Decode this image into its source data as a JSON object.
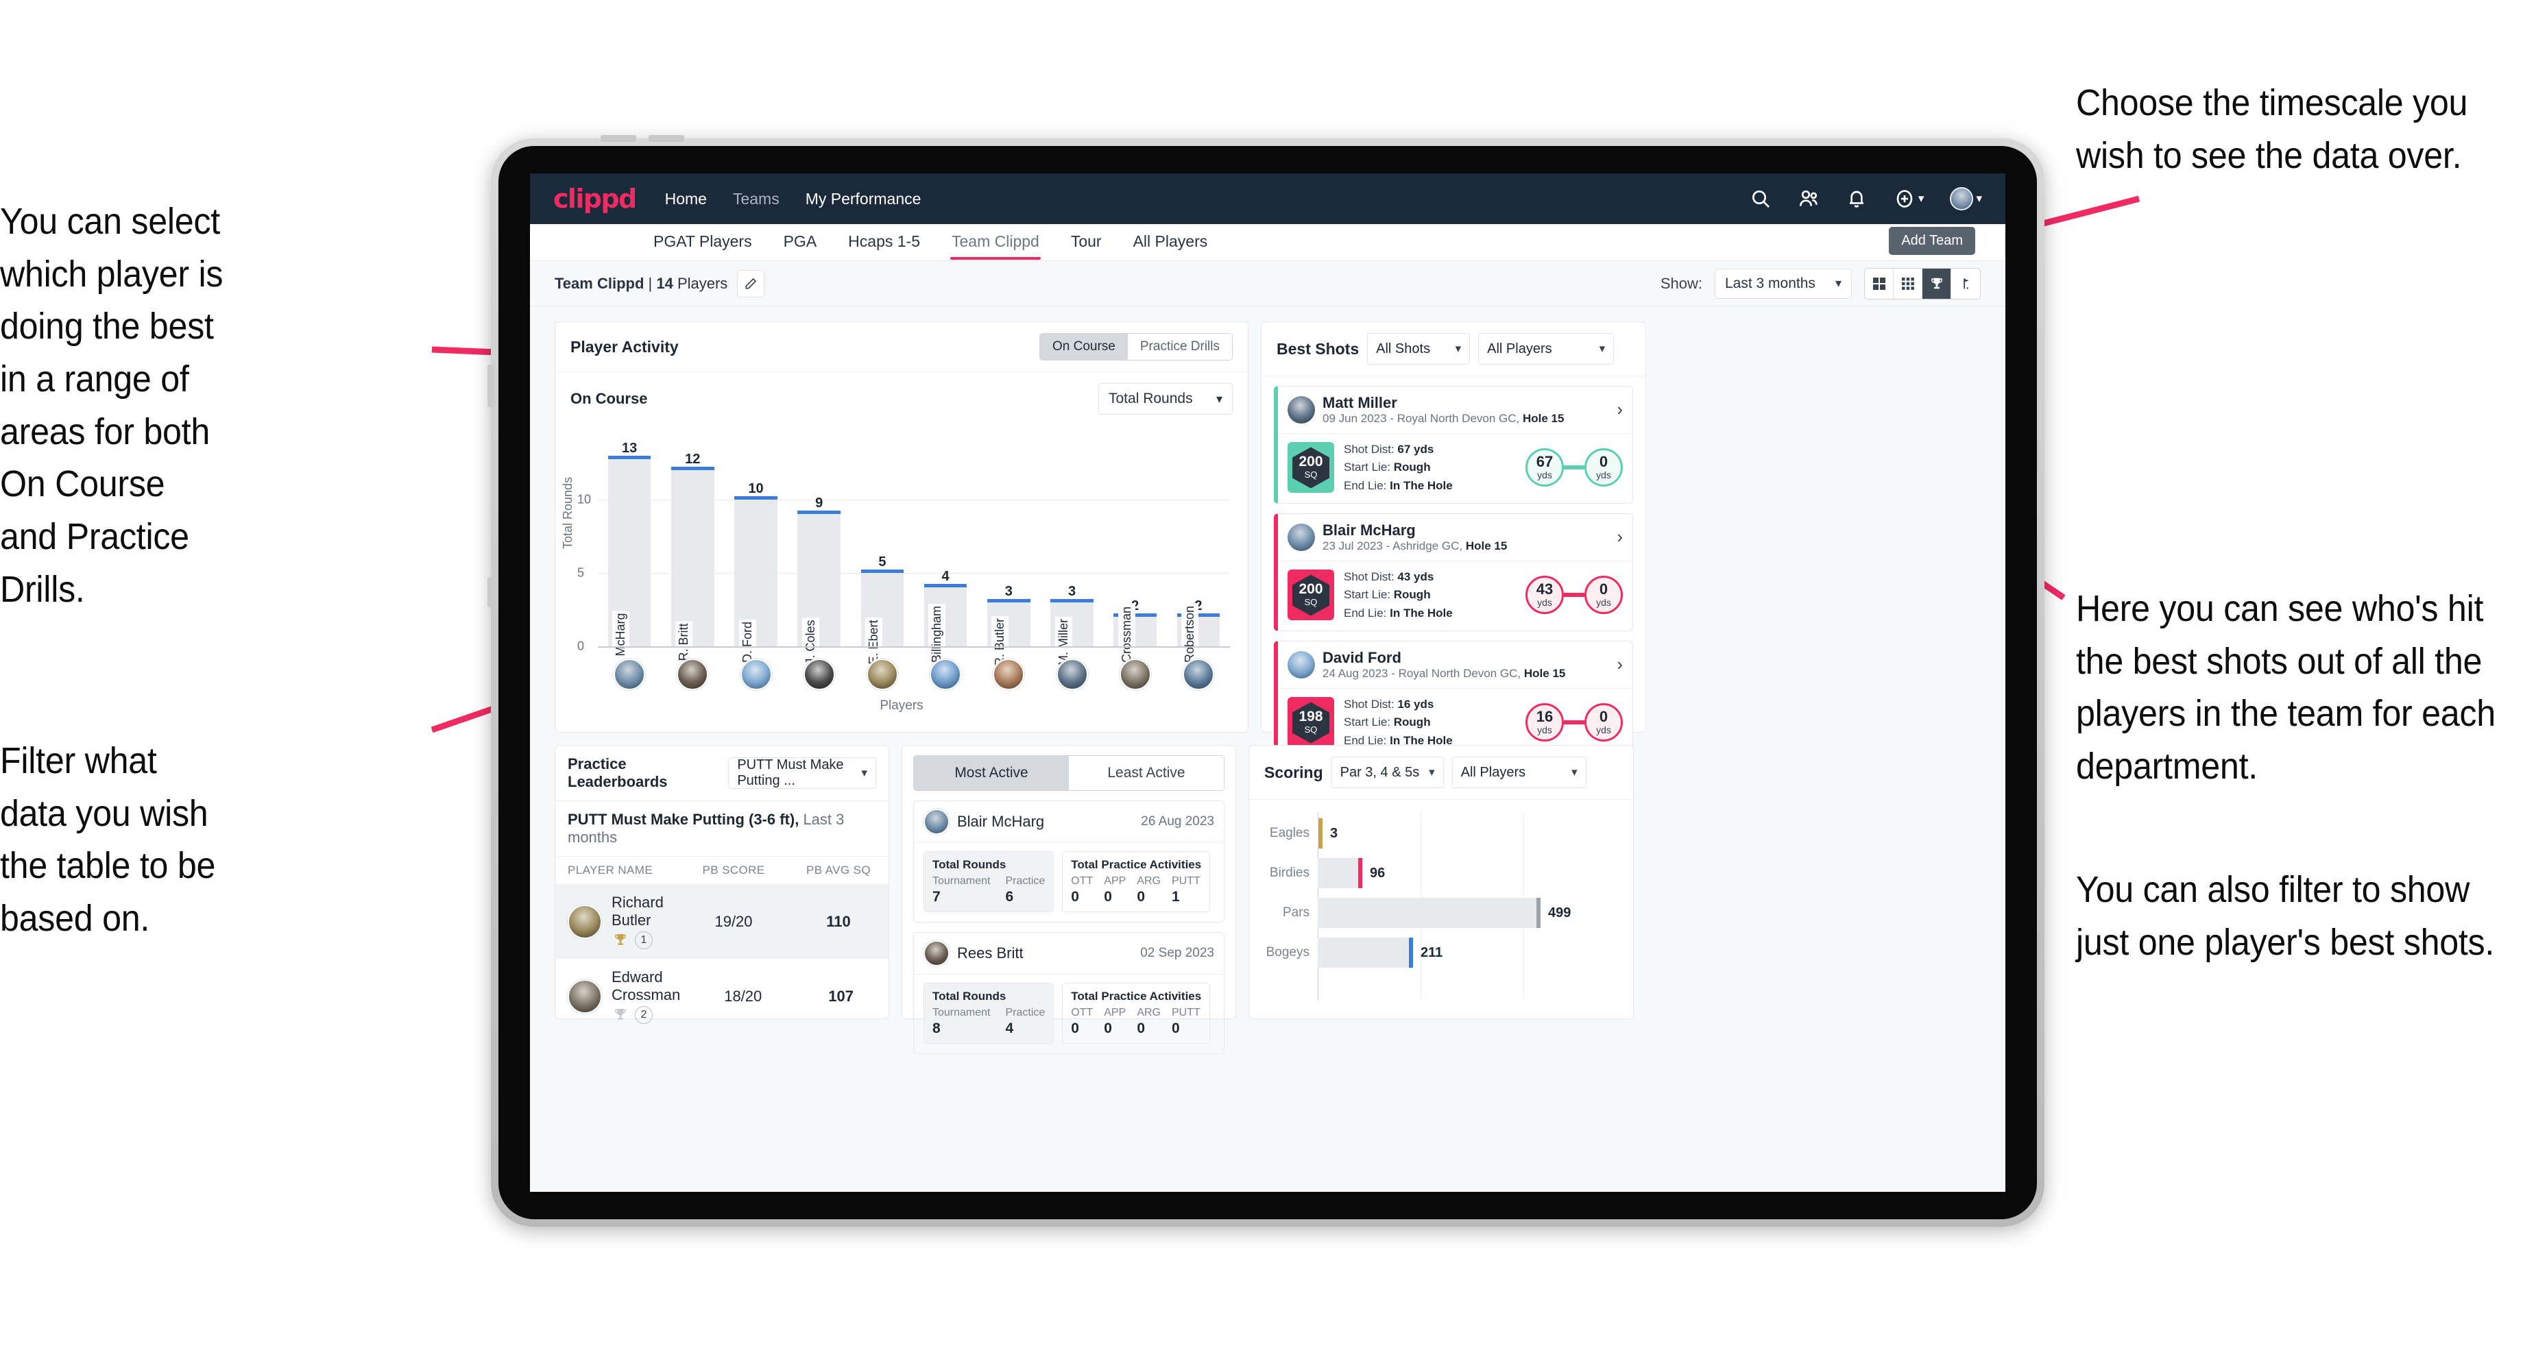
{
  "annotations": {
    "left_top": "You can select which player is doing the best in a range of areas for both On Course and Practice Drills.",
    "left_bottom": "Filter what data you wish the table to be based on.",
    "right_top": "Choose the timescale you wish to see the data over.",
    "right_mid": "Here you can see who's hit the best shots out of all the players in the team for each department.",
    "right_bottom": "You can also filter to show just one player's best shots."
  },
  "navbar": {
    "logo": "clippd",
    "links": [
      "Home",
      "Teams",
      "My Performance"
    ],
    "icons": [
      "search-icon",
      "people-icon",
      "bell-icon",
      "plus-circle-icon",
      "avatar"
    ]
  },
  "tabs": {
    "items": [
      "PGAT Players",
      "PGA",
      "Hcaps 1-5",
      "Team Clippd",
      "Tour",
      "All Players"
    ],
    "active": "Team Clippd",
    "add_team": "Add Team"
  },
  "toolbar": {
    "team_name": "Team Clippd",
    "team_sep": " | ",
    "player_count": "14",
    "players_word": " Players",
    "show_label": "Show:",
    "timescale": "Last 3 months",
    "view_modes": [
      "grid-large-icon",
      "grid-small-icon",
      "trophy-icon",
      "flag-icon"
    ],
    "active_view": "trophy-icon"
  },
  "player_activity": {
    "title": "Player Activity",
    "segments": [
      "On Course",
      "Practice Drills"
    ],
    "active_segment": "On Course",
    "sub_label": "On Course",
    "metric": "Total Rounds"
  },
  "chart_data": [
    {
      "type": "bar",
      "title": "Player Activity",
      "xlabel": "Players",
      "ylabel": "Total Rounds",
      "ylim": [
        0,
        14
      ],
      "yticks": [
        0,
        5,
        10
      ],
      "grid": true,
      "categories": [
        "B. McHarg",
        "R. Britt",
        "D. Ford",
        "J. Coles",
        "E. Ebert",
        "D. Billingham",
        "R. Butler",
        "M. Miller",
        "E. Crossman",
        "C. Robertson"
      ],
      "values": [
        13,
        12,
        10,
        9,
        5,
        4,
        3,
        3,
        2,
        2
      ]
    },
    {
      "type": "bar",
      "orientation": "horizontal",
      "title": "Scoring",
      "categories": [
        "Eagles",
        "Birdies",
        "Pars",
        "Bogeys"
      ],
      "values": [
        3,
        96,
        499,
        211
      ],
      "colors": [
        "#c9a14a",
        "#ef2b62",
        "#9aa3ad",
        "#3b7dd8"
      ],
      "xlim": [
        0,
        620
      ],
      "grid": true
    }
  ],
  "best_shots": {
    "title": "Best Shots",
    "filter_shots": "All Shots",
    "filter_players": "All Players",
    "shots": [
      {
        "player": "Matt Miller",
        "meta_date": "09 Jun 2023",
        "meta_course": " - Royal North Devon GC, ",
        "meta_hole": "Hole 15",
        "sq": "200",
        "sq_unit": "SQ",
        "accent": "teal",
        "shot_dist_label": "Shot Dist: ",
        "shot_dist": "67 yds",
        "start_lie_label": "Start Lie: ",
        "start_lie": "Rough",
        "end_lie_label": "End Lie: ",
        "end_lie": "In The Hole",
        "from_val": "67",
        "from_unit": "yds",
        "to_val": "0",
        "to_unit": "yds"
      },
      {
        "player": "Blair McHarg",
        "meta_date": "23 Jul 2023",
        "meta_course": " - Ashridge GC, ",
        "meta_hole": "Hole 15",
        "sq": "200",
        "sq_unit": "SQ",
        "accent": "pink",
        "shot_dist_label": "Shot Dist: ",
        "shot_dist": "43 yds",
        "start_lie_label": "Start Lie: ",
        "start_lie": "Rough",
        "end_lie_label": "End Lie: ",
        "end_lie": "In The Hole",
        "from_val": "43",
        "from_unit": "yds",
        "to_val": "0",
        "to_unit": "yds"
      },
      {
        "player": "David Ford",
        "meta_date": "24 Aug 2023",
        "meta_course": " - Royal North Devon GC, ",
        "meta_hole": "Hole 15",
        "sq": "198",
        "sq_unit": "SQ",
        "accent": "pink",
        "shot_dist_label": "Shot Dist: ",
        "shot_dist": "16 yds",
        "start_lie_label": "Start Lie: ",
        "start_lie": "Rough",
        "end_lie_label": "End Lie: ",
        "end_lie": "In The Hole",
        "from_val": "16",
        "from_unit": "yds",
        "to_val": "0",
        "to_unit": "yds"
      }
    ]
  },
  "practice_leaderboards": {
    "title": "Practice Leaderboards",
    "drill_filter": "PUTT Must Make Putting ...",
    "sub_bold": "PUTT Must Make Putting (3-6 ft),",
    "sub_rest": " Last 3 months",
    "columns": [
      "PLAYER NAME",
      "PB SCORE",
      "PB AVG SQ"
    ],
    "rows": [
      {
        "name": "Richard Butler",
        "rank": "1",
        "pb_score": "19/20",
        "pb_avg_sq": "110",
        "trophy": "gold"
      },
      {
        "name": "Edward Crossman",
        "rank": "2",
        "pb_score": "18/20",
        "pb_avg_sq": "107",
        "trophy": "silver"
      }
    ]
  },
  "activity": {
    "tabs": [
      "Most Active",
      "Least Active"
    ],
    "active_tab": "Most Active",
    "rounds_title": "Total Rounds",
    "practice_title": "Total Practice Activities",
    "rounds_keys": [
      "Tournament",
      "Practice"
    ],
    "practice_keys": [
      "OTT",
      "APP",
      "ARG",
      "PUTT"
    ],
    "cards": [
      {
        "name": "Blair McHarg",
        "date": "26 Aug 2023",
        "rounds": [
          "7",
          "6"
        ],
        "practice": [
          "0",
          "0",
          "0",
          "1"
        ]
      },
      {
        "name": "Rees Britt",
        "date": "02 Sep 2023",
        "rounds": [
          "8",
          "4"
        ],
        "practice": [
          "0",
          "0",
          "0",
          "0"
        ]
      }
    ]
  },
  "scoring": {
    "title": "Scoring",
    "filter_par": "Par 3, 4 & 5s",
    "filter_players": "All Players"
  },
  "colors": {
    "brand_pink": "#ef2b62",
    "navy": "#1b2a3a",
    "bar_blue": "#3b7dd8",
    "teal": "#5ccfb0",
    "gold": "#c9a14a"
  }
}
